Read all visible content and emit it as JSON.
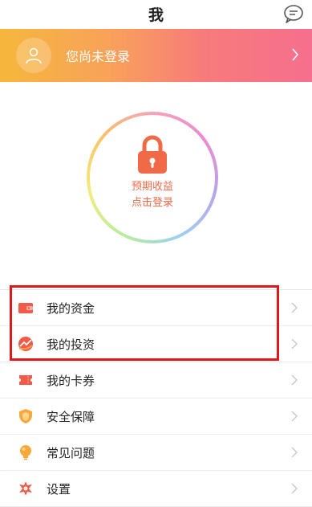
{
  "header": {
    "title": "我",
    "message_icon": "message-icon"
  },
  "profile": {
    "login_prompt": "您尚未登录",
    "avatar_icon": "user-icon"
  },
  "earnings": {
    "line1": "预期收益",
    "line2": "点击登录",
    "icon": "lock-icon"
  },
  "menu": [
    {
      "label": "我的资金",
      "icon": "wallet-icon"
    },
    {
      "label": "我的投资",
      "icon": "investment-icon"
    },
    {
      "label": "我的卡券",
      "icon": "coupon-icon"
    },
    {
      "label": "安全保障",
      "icon": "shield-icon"
    },
    {
      "label": "常见问题",
      "icon": "lightbulb-icon"
    },
    {
      "label": "设置",
      "icon": "settings-icon"
    }
  ],
  "colors": {
    "accent": "#f06a47",
    "highlight_border": "#e0181b"
  }
}
